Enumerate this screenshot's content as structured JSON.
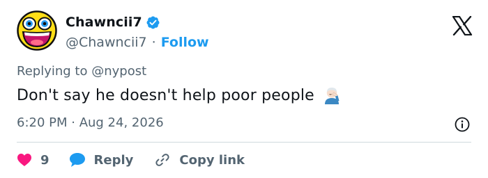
{
  "author": {
    "display_name": "Chawncii7",
    "handle": "@Chawncii7",
    "separator": "·",
    "follow_label": "Follow"
  },
  "reply_context": {
    "prefix": "Replying to",
    "mention": "@nypost"
  },
  "tweet": {
    "text": "Don't say he doesn't help poor people",
    "emoji": "facepalm-emoji",
    "timestamp": "6:20 PM · Aug 24, 2026"
  },
  "actions": {
    "like_count": "9",
    "reply_label": "Reply",
    "copy_link_label": "Copy link"
  },
  "colors": {
    "accent": "#1d9bf0",
    "like": "#f91880",
    "secondary_text": "#536471",
    "divider": "#cfd9de"
  },
  "icons": [
    "avatar-awesome-face",
    "verified-badge-icon",
    "x-logo-icon",
    "info-icon",
    "heart-icon",
    "reply-bubble-icon",
    "link-icon"
  ]
}
